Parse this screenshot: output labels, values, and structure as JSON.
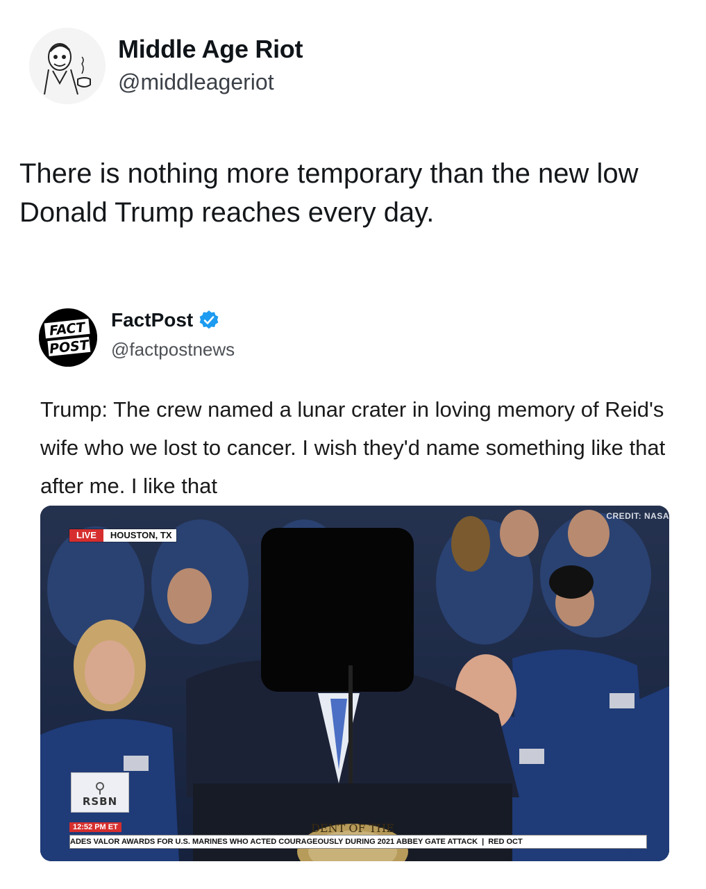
{
  "tweet": {
    "display_name": "Middle Age Riot",
    "handle": "@middleageriot",
    "text": "There is nothing more temporary than the new low Donald Trump reaches every day.",
    "avatar_icon": "cartoon-man-pipe-avatar"
  },
  "quote": {
    "display_name": "FactPost",
    "handle": "@factpostnews",
    "verified": true,
    "verified_color": "#1d9bf0",
    "avatar_lines": [
      "FACT",
      "POST"
    ],
    "text": "Trump: The crew named a lunar crater in loving memory of Reid's wife who we lost to cancer. I wish they'd name something like that after me. I like that"
  },
  "media": {
    "live_label": "LIVE",
    "location_label": "HOUSTON, TX",
    "credit": "CREDIT: NASA",
    "network": "RSBN",
    "time": "12:52 PM ET",
    "ticker": "ADES VALOR AWARDS FOR U.S. MARINES WHO ACTED COURAGEOUSLY DURING 2021 ABBEY GATE ATTACK",
    "ticker_next": "RED OCT",
    "seal_text": "DENT OF THE"
  }
}
